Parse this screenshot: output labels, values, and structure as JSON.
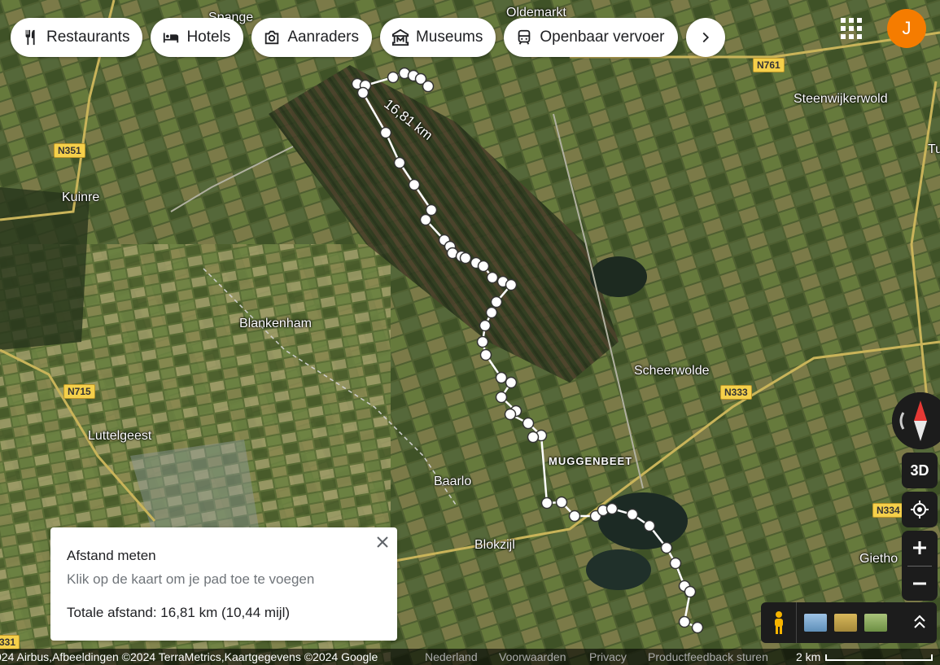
{
  "chips": [
    {
      "label": "Restaurants",
      "icon": "restaurant-icon"
    },
    {
      "label": "Hotels",
      "icon": "hotel-icon"
    },
    {
      "label": "Aanraders",
      "icon": "camera-icon"
    },
    {
      "label": "Museums",
      "icon": "museum-icon"
    },
    {
      "label": "Openbaar vervoer",
      "icon": "transit-icon"
    }
  ],
  "avatar_letter": "J",
  "place_labels": {
    "spange": "Spange",
    "oldemarkt": "Oldemarkt",
    "steenwijkerwold": "Steenwijkerwold",
    "tuk": "Tu",
    "kuinre": "Kuinre",
    "blankenham": "Blankenham",
    "scheerwolde": "Scheerwolde",
    "luttelgeest": "Luttelgeest",
    "muggenbeet": "MUGGENBEET",
    "baarlo": "Baarlo",
    "blokzijl": "Blokzijl",
    "giethoorn": "Gietho"
  },
  "road_labels": {
    "n761": "N761",
    "n351": "N351",
    "n715": "N715",
    "n333": "N333",
    "n334": "N334",
    "n331": "331"
  },
  "route_distance_label": "16,81 km",
  "measure_panel": {
    "title": "Afstand meten",
    "hint": "Klik op de kaart om je pad toe te voegen",
    "total": "Totale afstand: 16,81 km (10,44 mijl)"
  },
  "controls": {
    "btn3d": "3D"
  },
  "footer": {
    "attribution": "024 Airbus,Afbeeldingen ©2024 TerraMetrics,Kaartgegevens ©2024 Google",
    "country": "Nederland",
    "terms": "Voorwaarden",
    "privacy": "Privacy",
    "feedback": "Productfeedback sturen",
    "scale": "2 km"
  }
}
